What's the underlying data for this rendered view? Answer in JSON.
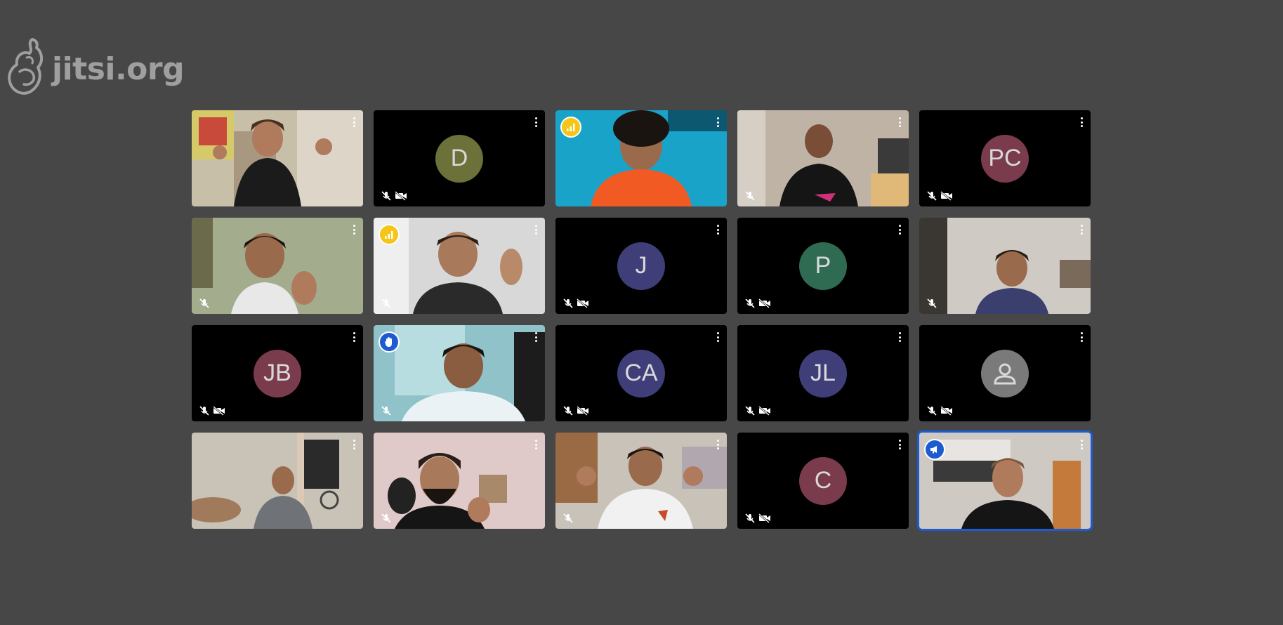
{
  "branding": {
    "logo_text": "jitsi.org",
    "logo_icon": "jitsi-logo-icon"
  },
  "participants": [
    {
      "id": "p1",
      "type": "video",
      "row": 1,
      "muted": false,
      "badge": ""
    },
    {
      "id": "p2",
      "type": "avatar",
      "initials": "D",
      "color": "#6b7139",
      "muted": true,
      "video_off": true
    },
    {
      "id": "p3",
      "type": "video",
      "badge": "connection-yellow"
    },
    {
      "id": "p4",
      "type": "video",
      "muted": true
    },
    {
      "id": "p5",
      "type": "avatar",
      "initials": "PC",
      "color": "#7a3b4d",
      "muted": true,
      "video_off": true
    },
    {
      "id": "p6",
      "type": "video",
      "muted": true
    },
    {
      "id": "p7",
      "type": "video",
      "muted": true,
      "badge": "connection-yellow"
    },
    {
      "id": "p8",
      "type": "avatar",
      "initials": "J",
      "color": "#3f3e78",
      "muted": true,
      "video_off": true
    },
    {
      "id": "p9",
      "type": "avatar",
      "initials": "P",
      "color": "#2e6b52",
      "muted": true,
      "video_off": true
    },
    {
      "id": "p10",
      "type": "video",
      "muted": true
    },
    {
      "id": "p11",
      "type": "avatar",
      "initials": "JB",
      "color": "#7a3b4d",
      "muted": true,
      "video_off": true
    },
    {
      "id": "p12",
      "type": "video",
      "muted": true,
      "badge": "raised-hand"
    },
    {
      "id": "p13",
      "type": "avatar",
      "initials": "CA",
      "color": "#3f3e78",
      "muted": true,
      "video_off": true
    },
    {
      "id": "p14",
      "type": "avatar",
      "initials": "JL",
      "color": "#3f3e78",
      "muted": true,
      "video_off": true
    },
    {
      "id": "p15",
      "type": "avatar",
      "initials": "",
      "color": "#7a7a7a",
      "muted": true,
      "video_off": true,
      "icon": "user-icon"
    },
    {
      "id": "p16",
      "type": "video"
    },
    {
      "id": "p17",
      "type": "video",
      "muted": true
    },
    {
      "id": "p18",
      "type": "video",
      "muted": true
    },
    {
      "id": "p19",
      "type": "avatar",
      "initials": "C",
      "color": "#7a3b4d",
      "muted": true,
      "video_off": true
    },
    {
      "id": "p20",
      "type": "video",
      "badge": "dominant-speaker",
      "active": true
    }
  ],
  "colors": {
    "background": "#474747",
    "tile_background": "#000000",
    "active_border": "#1f5bd0",
    "connection_indicator": "#f5c518"
  }
}
